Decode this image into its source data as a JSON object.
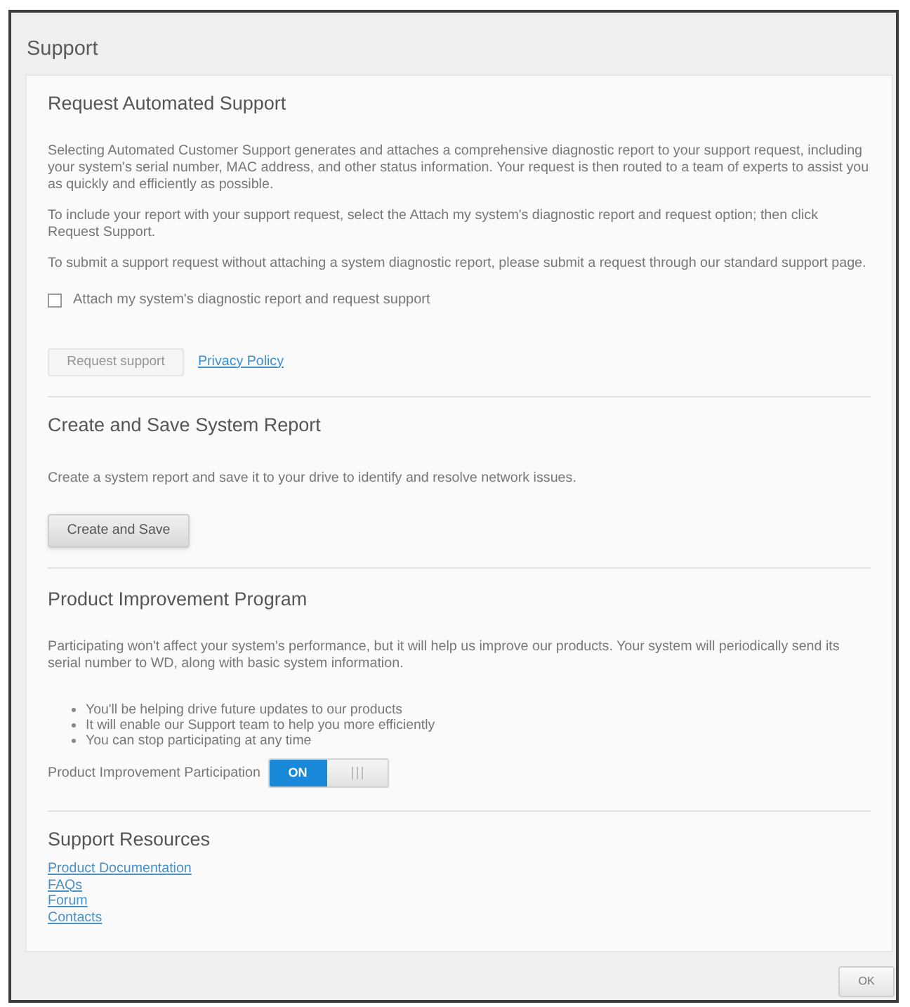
{
  "window": {
    "title": "Support"
  },
  "sections": [
    {
      "title": "Request Automated Support",
      "blocks": [
        {
          "kind": "paragraph",
          "text": "Selecting Automated Customer Support generates and attaches a comprehensive diagnostic report to your support request, including your system's serial number, MAC address, and other status information. Your request is then routed to a team of experts to assist you as quickly and efficiently as possible."
        },
        {
          "kind": "paragraph",
          "text": "To include your report with your support request, select the Attach my system's diagnostic report and request option; then click Request Support."
        },
        {
          "kind": "paragraph",
          "text": "To submit a support request without attaching a system diagnostic report, please submit a request through our standard support page."
        },
        {
          "kind": "checkbox",
          "label": "Attach my system's diagnostic report and request support",
          "checked": false
        },
        {
          "kind": "actions",
          "button": {
            "label": "Request support",
            "disabled": true
          },
          "link": "Privacy Policy"
        }
      ]
    },
    {
      "title": "Create and Save System Report",
      "blocks": [
        {
          "kind": "paragraph",
          "text": "Create a system report and save it to your drive to identify and resolve network issues."
        },
        {
          "kind": "button",
          "label": "Create and Save"
        }
      ]
    },
    {
      "title": "Product Improvement Program",
      "blocks": [
        {
          "kind": "paragraph",
          "text": "Participating won't affect your system's performance, but it will help us improve our products. Your system will periodically send its serial number to WD, along with basic system information."
        },
        {
          "kind": "bullets",
          "items": [
            "You'll be helping drive future updates to our products",
            "It will enable our Support team to help you more efficiently",
            "You can stop participating at any time"
          ]
        },
        {
          "kind": "toggle",
          "label": "Product Improvement Participation",
          "on": true,
          "on_label": "ON"
        }
      ]
    },
    {
      "title": "Support Resources",
      "blocks": [
        {
          "kind": "links",
          "items": [
            "Product Documentation",
            "FAQs",
            "Forum",
            "Contacts"
          ]
        }
      ]
    }
  ],
  "footer": {
    "button": "OK"
  }
}
